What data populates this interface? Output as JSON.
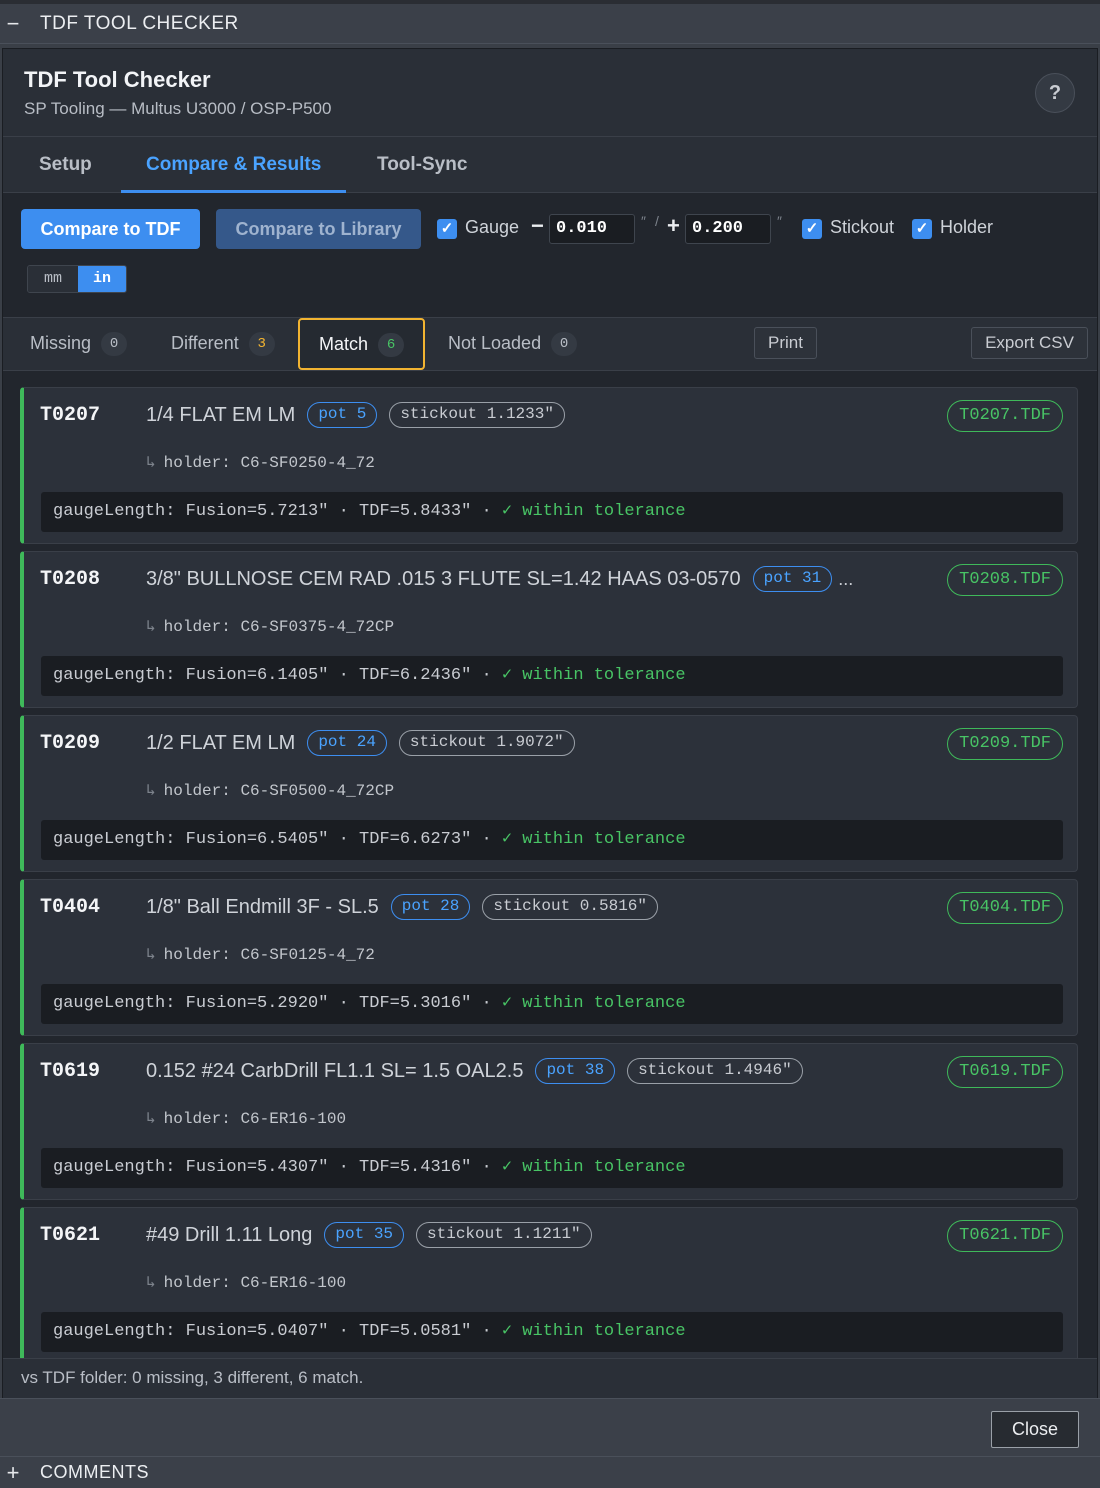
{
  "panel": {
    "collapse_symbol": "−",
    "title": "TDF TOOL CHECKER"
  },
  "dialog": {
    "title": "TDF Tool Checker",
    "subtitle": "SP Tooling — Multus U3000 / OSP-P500",
    "help_symbol": "?"
  },
  "tabs": [
    {
      "label": "Setup",
      "active": false
    },
    {
      "label": "Compare & Results",
      "active": true
    },
    {
      "label": "Tool-Sync",
      "active": false
    }
  ],
  "toolbar": {
    "compare_tdf_label": "Compare to TDF",
    "compare_library_label": "Compare to Library",
    "gauge": {
      "checked": true,
      "label": "Gauge",
      "minus": "−",
      "minus_value": "0.010",
      "plus": "+",
      "plus_value": "0.200",
      "unit_mark": "″",
      "separator": "/"
    },
    "stickout": {
      "checked": true,
      "label": "Stickout"
    },
    "holder": {
      "checked": true,
      "label": "Holder"
    },
    "check_symbol": "✓",
    "units": {
      "mm": "mm",
      "in": "in",
      "selected": "in"
    }
  },
  "filters": [
    {
      "label": "Missing",
      "count": "0",
      "count_color": "#b9bec6",
      "active": false
    },
    {
      "label": "Different",
      "count": "3",
      "count_color": "#f2b431",
      "active": false
    },
    {
      "label": "Match",
      "count": "6",
      "count_color": "#48c465",
      "active": true
    },
    {
      "label": "Not Loaded",
      "count": "0",
      "count_color": "#b9bec6",
      "active": false
    }
  ],
  "actions": {
    "print": "Print",
    "export": "Export CSV"
  },
  "results": [
    {
      "tool": "T0207",
      "name": "1/4 FLAT EM LM",
      "pot": "pot 5",
      "stickout": "stickout 1.1233″",
      "holder": "holder: C6-SF0250-4_72",
      "tdf": "T0207.TDF",
      "gauge": "gaugeLength: Fusion=5.7213″ · TDF=5.8433″ · ",
      "status": "✓ within tolerance"
    },
    {
      "tool": "T0208",
      "name": "3/8\" BULLNOSE CEM RAD .015 3 FLUTE SL=1.42 HAAS 03-0570",
      "pot": "pot 31",
      "stickout": "",
      "more": "...",
      "holder": "holder: C6-SF0375-4_72CP",
      "tdf": "T0208.TDF",
      "gauge": "gaugeLength: Fusion=6.1405″ · TDF=6.2436″ · ",
      "status": "✓ within tolerance"
    },
    {
      "tool": "T0209",
      "name": "1/2 FLAT EM LM",
      "pot": "pot 24",
      "stickout": "stickout 1.9072″",
      "holder": "holder: C6-SF0500-4_72CP",
      "tdf": "T0209.TDF",
      "gauge": "gaugeLength: Fusion=6.5405″ · TDF=6.6273″ · ",
      "status": "✓ within tolerance"
    },
    {
      "tool": "T0404",
      "name": "1/8\" Ball Endmill 3F - SL.5",
      "pot": "pot 28",
      "stickout": "stickout 0.5816″",
      "holder": "holder: C6-SF0125-4_72",
      "tdf": "T0404.TDF",
      "gauge": "gaugeLength: Fusion=5.2920″ · TDF=5.3016″ · ",
      "status": "✓ within tolerance"
    },
    {
      "tool": "T0619",
      "name": "0.152 #24 CarbDrill FL1.1 SL= 1.5 OAL2.5",
      "pot": "pot 38",
      "stickout": "stickout 1.4946″",
      "holder": "holder: C6-ER16-100",
      "tdf": "T0619.TDF",
      "gauge": "gaugeLength: Fusion=5.4307″ · TDF=5.4316″ · ",
      "status": "✓ within tolerance"
    },
    {
      "tool": "T0621",
      "name": "#49 Drill 1.11 Long",
      "pot": "pot 35",
      "stickout": "stickout 1.1211″",
      "holder": "holder: C6-ER16-100",
      "tdf": "T0621.TDF",
      "gauge": "gaugeLength: Fusion=5.0407″ · TDF=5.0581″ · ",
      "status": "✓ within tolerance"
    }
  ],
  "holder_arrow": "↳",
  "summary": "vs TDF folder: 0 missing, 3 different, 6 match.",
  "footer": {
    "close_label": "Close"
  },
  "comments": {
    "expand_symbol": "+",
    "title": "COMMENTS"
  },
  "colors": {
    "accent": "#3d8ef0",
    "match_green": "#3fb95a",
    "active_filter_border": "#f2b431",
    "background": "#22262d"
  }
}
